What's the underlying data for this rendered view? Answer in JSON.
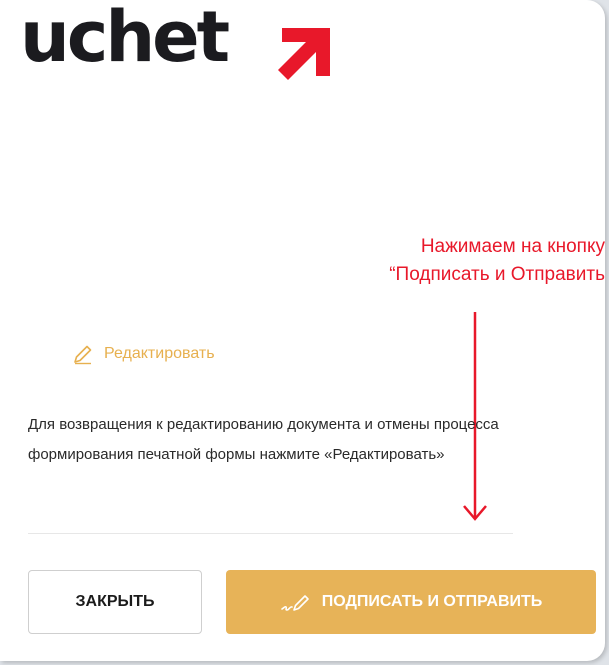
{
  "logo": {
    "text": "uchet",
    "arrow_icon": "arrow-up-right-icon",
    "arrow_color": "#e8182a"
  },
  "annotation": {
    "line1": "Нажимаем на кнопку",
    "line2": "“Подписать и Отправить",
    "color": "#e8182a"
  },
  "edit": {
    "label": "Редактировать",
    "icon": "pencil-icon",
    "color": "#e7b04f"
  },
  "description": "Для возвращения к редактированию документа и отмены процесса формирования печатной формы нажмите «Редактировать»",
  "buttons": {
    "close_label": "ЗАКРЫТЬ",
    "sign_label": "ПОДПИСАТЬ И ОТПРАВИТЬ",
    "sign_icon": "signature-icon",
    "sign_color": "#e7b358"
  }
}
